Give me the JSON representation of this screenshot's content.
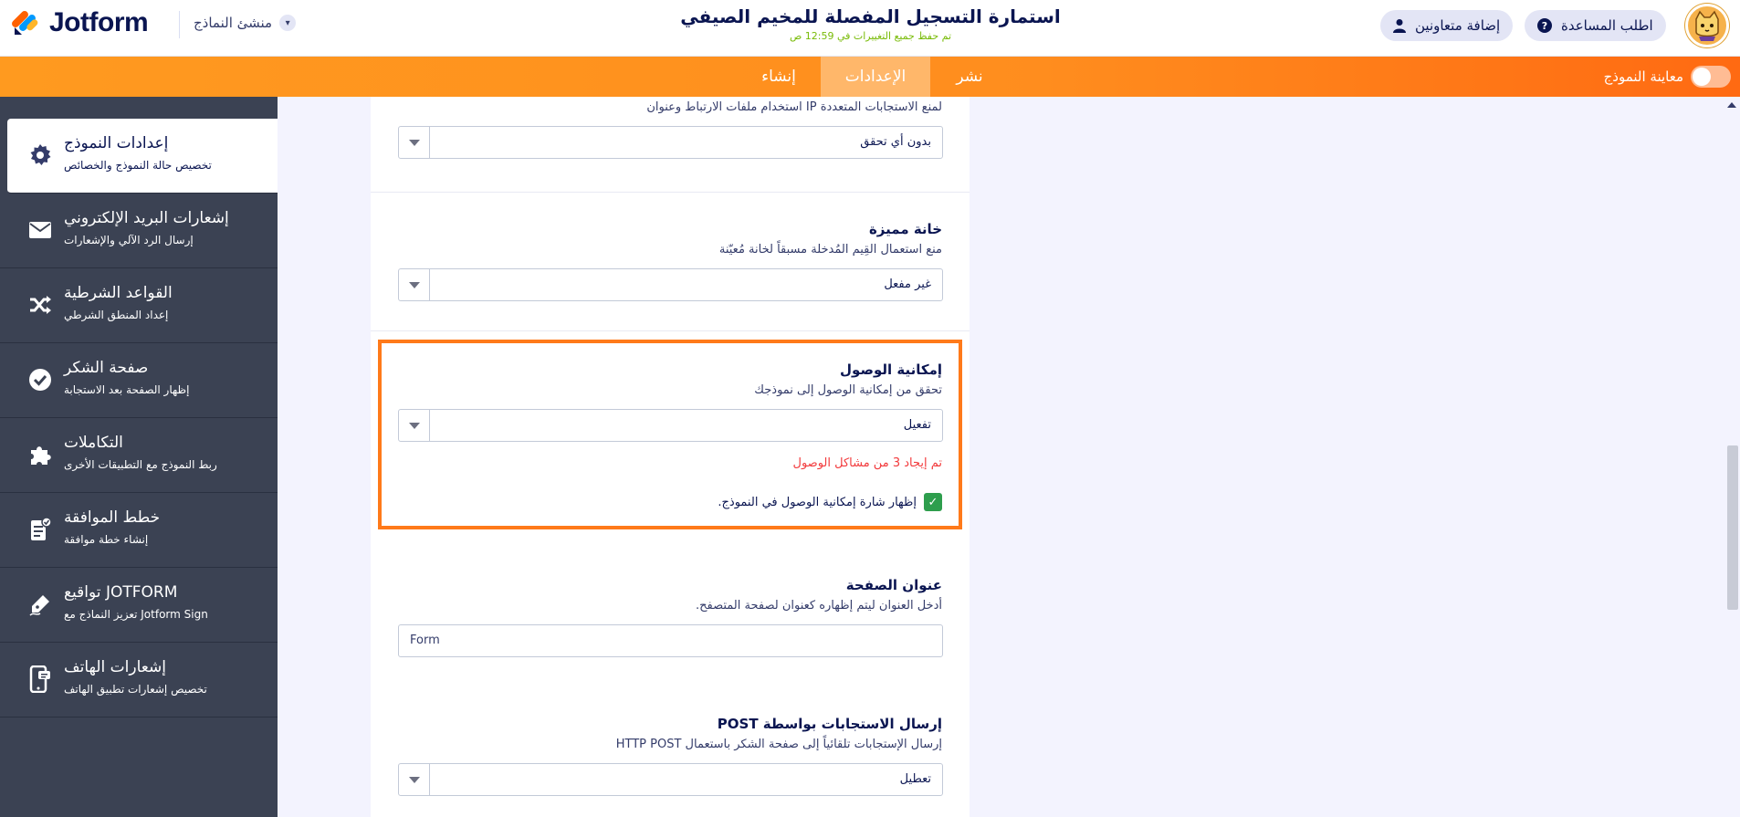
{
  "header": {
    "logo_text": "Jotform",
    "form_maker_label": "منشئ النماذج",
    "form_title": "استمارة التسجيل المفصلة للمخيم الصيفي",
    "saved_status": "تم حفظ جميع التغييرات في 12:59 ص",
    "help_label": "اطلب المساعدة",
    "collaborators_label": "إضافة متعاونين"
  },
  "nav": {
    "tabs": [
      {
        "label": "نشر"
      },
      {
        "label": "الإعدادات"
      },
      {
        "label": "إنشاء"
      }
    ],
    "preview_label": "معاينة النموذج"
  },
  "sidebar": {
    "items": [
      {
        "title": "إعدادات النموذج",
        "sub": "تخصيص حالة النموذج والخصائص",
        "icon": "gear-icon"
      },
      {
        "title": "إشعارات البريد الإلكتروني",
        "sub": "إرسال الرد الآلي والإشعارات",
        "icon": "envelope-icon"
      },
      {
        "title": "القواعد الشرطية",
        "sub": "إعداد المنطق الشرطي",
        "icon": "shuffle-icon"
      },
      {
        "title": "صفحة الشكر",
        "sub": "إظهار الصفحة بعد الاستجابة",
        "icon": "check-circle-icon"
      },
      {
        "title": "التكاملات",
        "sub": "ربط النموذج مع التطبيقات الأخرى",
        "icon": "puzzle-icon"
      },
      {
        "title": "خطط الموافقة",
        "sub": "إنشاء خطة موافقة",
        "icon": "approval-icon"
      },
      {
        "title": "تواقيع JOTFORM",
        "sub": "تعزيز النماذج مع Jotform Sign",
        "icon": "signature-pen-icon"
      },
      {
        "title": "إشعارات الهاتف",
        "sub": "تخصيص إشعارات تطبيق الهاتف",
        "icon": "phone-icon"
      }
    ]
  },
  "settings": {
    "ip_check": {
      "desc": "لمنع الاستجابات المتعددة IP استخدام ملفات الارتباط وعنوان",
      "value": "بدون أي تحقق"
    },
    "unique_field": {
      "title": "خانة مميزة",
      "desc": "منع استعمال القِيم المُدخلة مسبقاً لخانة مُعيّنة",
      "value": "غير مفعل"
    },
    "accessibility": {
      "title": "إمكانية الوصول",
      "desc": "تحقق من إمكانية الوصول إلى نموذجك",
      "value": "تفعيل",
      "warning": "تم إيجاد 3 من مشاكل الوصول",
      "badge_label": "إظهار شارة إمكانية الوصول في النموذج."
    },
    "page_title": {
      "title": "عنوان الصفحة",
      "desc": "أدخل العنوان ليتم إظهاره كعنوان لصفحة المتصفح.",
      "value": "Form"
    },
    "post": {
      "title": "إرسال الاستجابات بواسطة POST",
      "desc": "إرسال الإستجابات تلقائياً إلى صفحة الشكر باستعمال HTTP POST",
      "value": "تعطيل"
    }
  },
  "colors": {
    "accent_orange": "#ff8d1e",
    "highlight_border": "#ff7a1a",
    "warning_red": "#f23a3c",
    "sidebar_bg": "#3b4253",
    "checkbox_green": "#2e9e4d"
  }
}
